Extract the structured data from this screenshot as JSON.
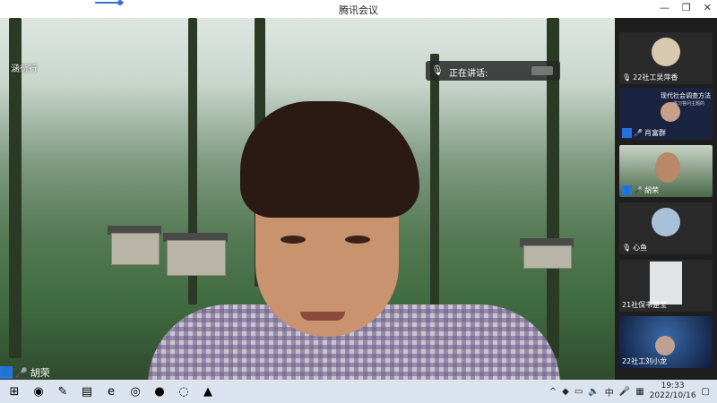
{
  "window": {
    "title": "腾讯会议",
    "progress": 0.9,
    "controls": {
      "minimize": "—",
      "restore": "❐",
      "close": "✕"
    }
  },
  "main_video": {
    "corner_label": "涵衍行",
    "speaking_label": "正在讲话:",
    "speaker_name": "胡荣"
  },
  "sidebar": {
    "participants": [
      {
        "name": "22社工吴萍香",
        "muted": true
      },
      {
        "name": "肖富群",
        "slide_title": "现代社会调查方法",
        "slide_subtitle": "练习答问主题的"
      },
      {
        "name": "胡荣"
      },
      {
        "name": "心鱼",
        "muted": true
      },
      {
        "name": "21社保韦楚莹"
      },
      {
        "name": "22社工刘小龙"
      }
    ]
  },
  "taskbar": {
    "apps": [
      "start-icon",
      "chrome-icon",
      "notepad-icon",
      "file-explorer-icon",
      "edge-icon",
      "browser-icon",
      "color-app-icon",
      "app-icon",
      "tencent-meeting-icon"
    ],
    "tray": {
      "ime": "中",
      "time": "19:33",
      "date": "2022/10/16"
    }
  },
  "colors": {
    "accent": "#2b72e0",
    "sidebar_bg": "#1e1e1e",
    "taskbar_bg": "#dbe3ef"
  }
}
